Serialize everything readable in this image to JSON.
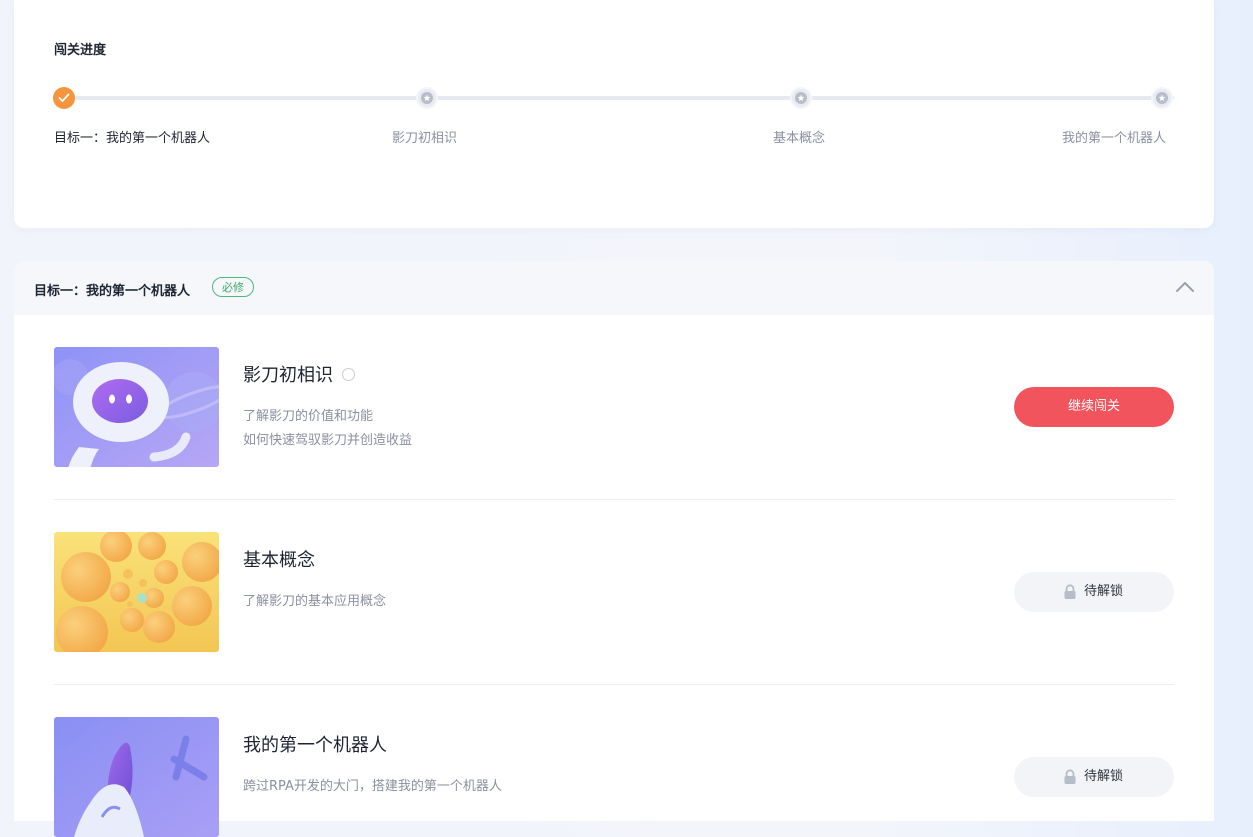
{
  "progress": {
    "title": "闯关进度",
    "steps": [
      {
        "label": "目标一：我的第一个机器人",
        "state": "done"
      },
      {
        "label": "影刀初相识",
        "state": "locked"
      },
      {
        "label": "基本概念",
        "state": "locked"
      },
      {
        "label": "我的第一个机器人",
        "state": "locked"
      }
    ]
  },
  "goal": {
    "title": "目标一：我的第一个机器人",
    "badge": "必修",
    "collapse_icon": "chevron-up-icon"
  },
  "lessons": [
    {
      "title": "影刀初相识",
      "desc": [
        "了解影刀的价值和功能",
        "如何快速驾驭影刀并创造收益"
      ],
      "action": "继续闯关",
      "status": "in-progress",
      "thumb_icon": "astronaut-illustration"
    },
    {
      "title": "基本概念",
      "desc": [
        "了解影刀的基本应用概念"
      ],
      "action": "待解锁",
      "status": "locked",
      "thumb_icon": "bubbles-illustration"
    },
    {
      "title": "我的第一个机器人",
      "desc": [
        "跨过RPA开发的大门，搭建我的第一个机器人"
      ],
      "action": "待解锁",
      "status": "locked",
      "thumb_icon": "rocket-illustration"
    }
  ],
  "colors": {
    "accent_orange": "#f6953e",
    "continue_red": "#f2545d",
    "badge_green": "#3daa6a"
  }
}
